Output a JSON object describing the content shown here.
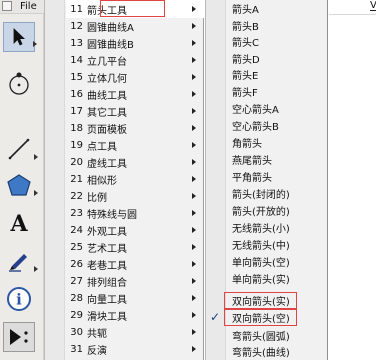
{
  "app": {
    "file_menu_label": "File",
    "right_menu_label": "V"
  },
  "toolbox": {
    "tools": [
      {
        "name": "arrow-select-tool",
        "icon": "arrow-cursor"
      },
      {
        "name": "point-tool",
        "icon": "dot"
      },
      {
        "name": "compass-tool",
        "icon": "circle-with-center"
      },
      {
        "name": "straightedge-tool",
        "icon": "line-segment"
      },
      {
        "name": "polygon-tool",
        "icon": "pentagon"
      },
      {
        "name": "text-tool",
        "icon": "letter-A",
        "glyph": "A"
      },
      {
        "name": "marker-tool",
        "icon": "pen"
      },
      {
        "name": "information-tool",
        "icon": "info-circle",
        "glyph": "i"
      },
      {
        "name": "custom-tool",
        "icon": "play-with-dots"
      }
    ]
  },
  "menu": {
    "items": [
      {
        "num": "11",
        "label": "箭头工具",
        "selected": true
      },
      {
        "num": "12",
        "label": "圆锥曲线A"
      },
      {
        "num": "13",
        "label": "圆锥曲线B"
      },
      {
        "num": "14",
        "label": "立几平台"
      },
      {
        "num": "15",
        "label": "立体几何"
      },
      {
        "num": "16",
        "label": "曲线工具"
      },
      {
        "num": "17",
        "label": "其它工具"
      },
      {
        "num": "18",
        "label": "页面模板"
      },
      {
        "num": "19",
        "label": "点工具"
      },
      {
        "num": "20",
        "label": "虚线工具"
      },
      {
        "num": "21",
        "label": "相似形"
      },
      {
        "num": "22",
        "label": "比例"
      },
      {
        "num": "23",
        "label": "特殊线与圆"
      },
      {
        "num": "24",
        "label": "外观工具"
      },
      {
        "num": "25",
        "label": "艺术工具"
      },
      {
        "num": "26",
        "label": "老巷工具"
      },
      {
        "num": "27",
        "label": "排列组合"
      },
      {
        "num": "28",
        "label": "向量工具"
      },
      {
        "num": "29",
        "label": "滑块工具"
      },
      {
        "num": "30",
        "label": "共轭"
      },
      {
        "num": "31",
        "label": "反演"
      }
    ]
  },
  "submenu": {
    "items": [
      {
        "label": "箭头A"
      },
      {
        "label": "箭头B"
      },
      {
        "label": "箭头C"
      },
      {
        "label": "箭头D"
      },
      {
        "label": "箭头E"
      },
      {
        "label": "箭头F"
      },
      {
        "label": "空心箭头A"
      },
      {
        "label": "空心箭头B"
      },
      {
        "label": "角箭头"
      },
      {
        "label": "燕尾箭头"
      },
      {
        "label": "平角箭头"
      },
      {
        "label": "箭头(封闭的)"
      },
      {
        "label": "箭头(开放的)"
      },
      {
        "label": "无线箭头(小)"
      },
      {
        "label": "无线箭头(中)"
      },
      {
        "label": "单向箭头(空)"
      },
      {
        "label": "单向箭头(实)"
      },
      {
        "label": "双向箭头(实)",
        "boxed": true
      },
      {
        "label": "双向箭头(空)",
        "boxed": true,
        "checked": true
      },
      {
        "label": "弯箭头(圆弧)"
      },
      {
        "label": "弯箭头(曲线)"
      }
    ],
    "check_mark": "✓"
  }
}
